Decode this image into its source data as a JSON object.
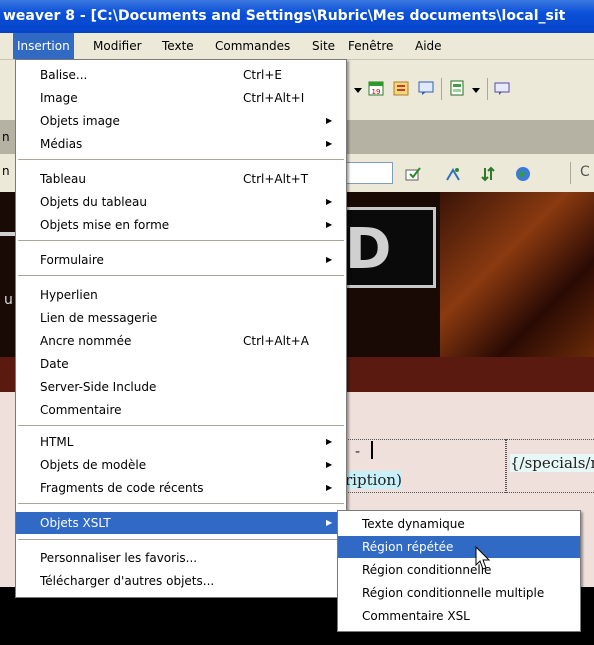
{
  "window": {
    "title": "weaver 8 - [C:\\Documents and Settings\\Rubric\\Mes documents\\local_sit"
  },
  "menubar": {
    "items": [
      {
        "label": "Insertion",
        "active": true
      },
      {
        "label": "Modifier"
      },
      {
        "label": "Texte"
      },
      {
        "label": "Commandes"
      },
      {
        "label": "Site"
      },
      {
        "label": "Fenêtre"
      },
      {
        "label": "Aide"
      }
    ]
  },
  "insert_menu": {
    "items": [
      {
        "label": "Balise...",
        "shortcut": "Ctrl+E"
      },
      {
        "label": "Image",
        "shortcut": "Ctrl+Alt+I"
      },
      {
        "label": "Objets image",
        "submenu": true
      },
      {
        "label": "Médias",
        "submenu": true
      },
      {
        "label": "Tableau",
        "shortcut": "Ctrl+Alt+T"
      },
      {
        "label": "Objets du tableau",
        "submenu": true
      },
      {
        "label": "Objets mise en forme",
        "submenu": true
      },
      {
        "label": "Formulaire",
        "submenu": true
      },
      {
        "label": "Hyperlien"
      },
      {
        "label": "Lien de messagerie"
      },
      {
        "label": "Ancre nommée",
        "shortcut": "Ctrl+Alt+A"
      },
      {
        "label": "Date"
      },
      {
        "label": "Server-Side Include"
      },
      {
        "label": "Commentaire"
      },
      {
        "label": "HTML",
        "submenu": true
      },
      {
        "label": "Objets de modèle",
        "submenu": true
      },
      {
        "label": "Fragments de code récents",
        "submenu": true
      },
      {
        "label": "Objets XSLT",
        "submenu": true,
        "highlighted": true
      },
      {
        "label": "Personnaliser les favoris..."
      },
      {
        "label": "Télécharger d'autres objets..."
      }
    ]
  },
  "xslt_submenu": {
    "items": [
      {
        "label": "Texte dynamique"
      },
      {
        "label": "Région répétée",
        "highlighted": true
      },
      {
        "label": "Région conditionnelle"
      },
      {
        "label": "Région conditionnelle multiple"
      },
      {
        "label": "Commentaire XSL"
      }
    ]
  },
  "document": {
    "fragment_1": "-",
    "fragment_2": "ription)",
    "fragment_3": "{/specials/n",
    "left_edge_1": "n",
    "left_edge_2": "n",
    "left_edge_3": "u",
    "banner_letters": "D",
    "toolbar_fragment": "C"
  },
  "colors": {
    "highlight": "#316ac5",
    "titlebar": "#0a50d8",
    "menu_bg": "#ece9d8"
  }
}
